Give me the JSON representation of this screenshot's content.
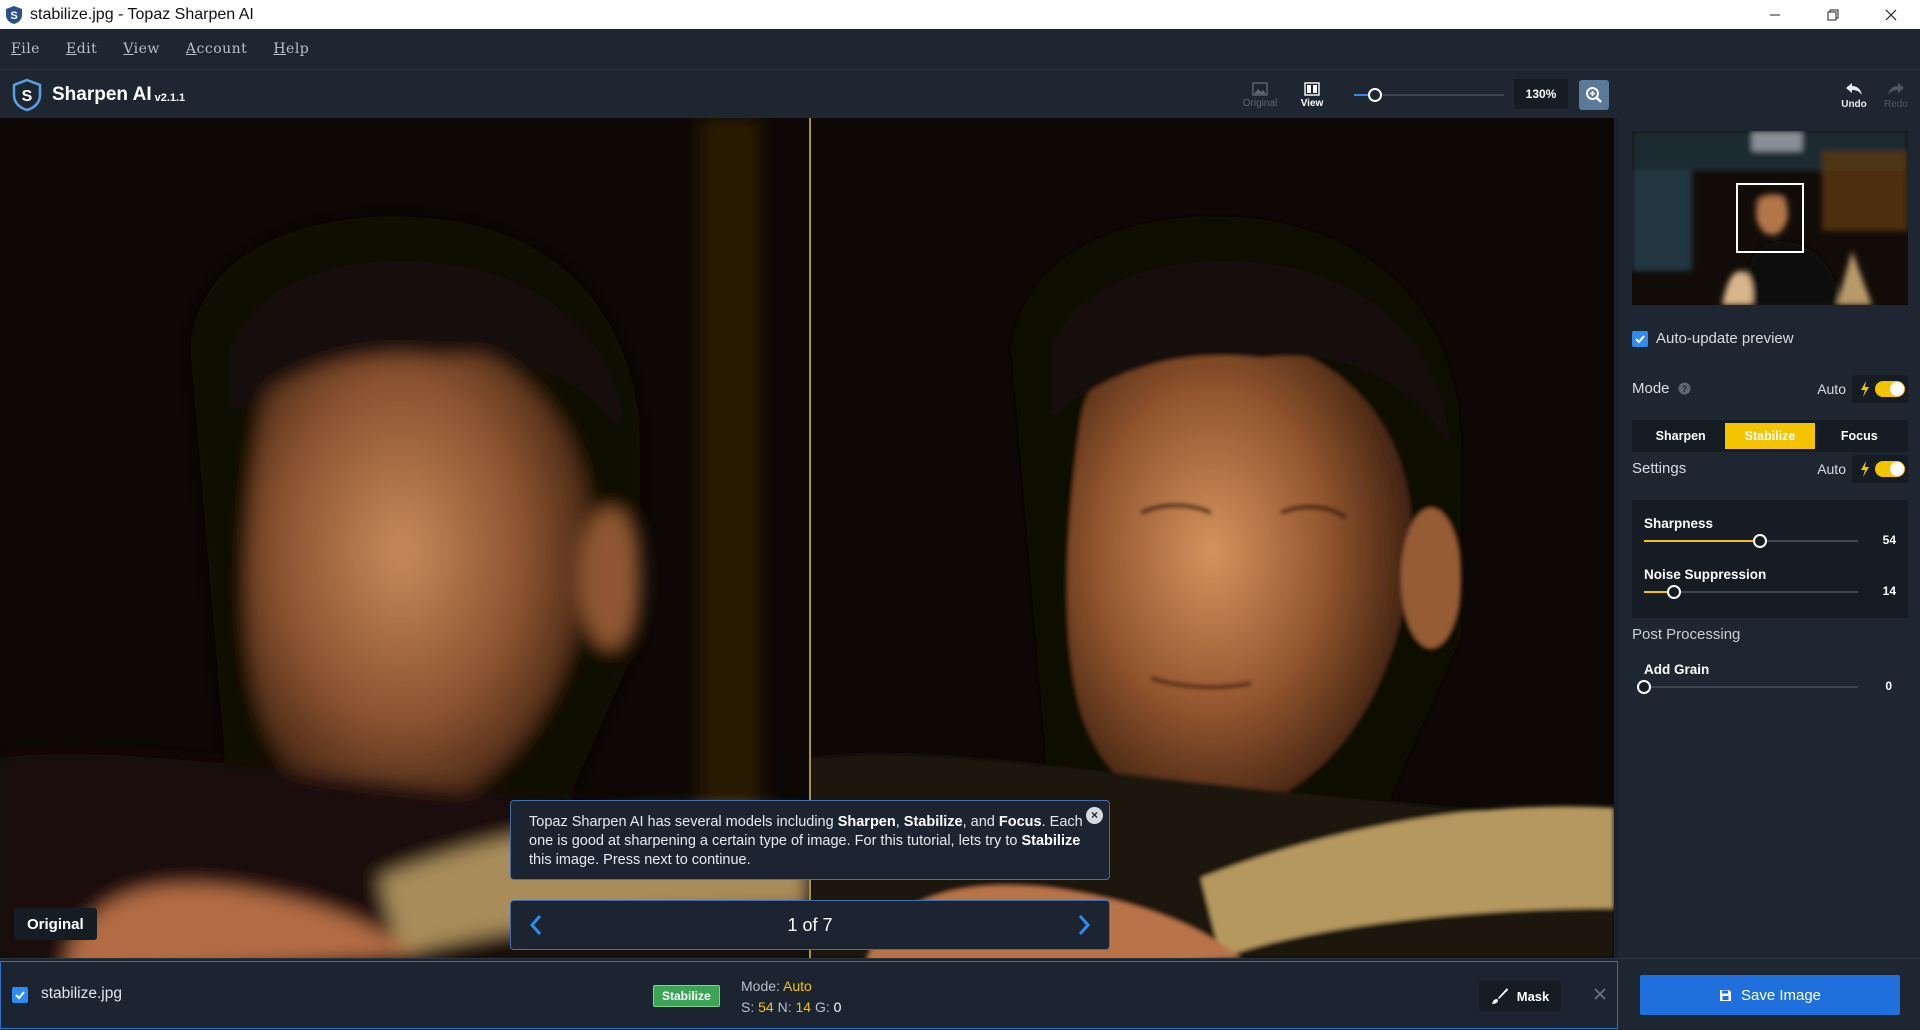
{
  "window": {
    "title": "stabilize.jpg - Topaz Sharpen AI",
    "controls": [
      "minimize",
      "restore",
      "close"
    ]
  },
  "menu": [
    "File",
    "Edit",
    "View",
    "Account",
    "Help"
  ],
  "toolbar": {
    "brand": "Sharpen AI",
    "version": "v2.1.1",
    "original_label": "Original",
    "view_label": "View",
    "zoom_value": "130%",
    "zoom_slider_fraction": 0.14,
    "undo_label": "Undo",
    "redo_label": "Redo"
  },
  "preview": {
    "original_badge": "Original",
    "tutorial": {
      "text_1": "Topaz Sharpen AI has several models including ",
      "b_sharpen": "Sharpen",
      "sep_1": ", ",
      "b_stabilize": "Stabilize",
      "sep_2": ", and ",
      "b_focus": "Focus",
      "text_2": ". Each one is good at sharpening a certain type of image. For this tutorial, lets try to ",
      "b_stabilize_2": "Stabilize",
      "text_3": " this image. Press next to continue.",
      "close_glyph": "×"
    },
    "pager": {
      "text": "1 of 7"
    }
  },
  "panel": {
    "auto_update_label": "Auto-update preview",
    "auto_update_checked": true,
    "mode": {
      "label": "Mode",
      "auto_label": "Auto",
      "auto_on": true,
      "options": [
        "Sharpen",
        "Stabilize",
        "Focus"
      ],
      "selected": "Stabilize"
    },
    "settings": {
      "label": "Settings",
      "auto_label": "Auto",
      "auto_on": true,
      "sliders": [
        {
          "label": "Sharpness",
          "value": "54",
          "fraction": 0.54
        },
        {
          "label": "Noise Suppression",
          "value": "14",
          "fraction": 0.14
        }
      ]
    },
    "post_processing": {
      "label": "Post Processing",
      "sliders": [
        {
          "label": "Add Grain",
          "value": "0",
          "fraction": 0.0
        }
      ]
    }
  },
  "bottom": {
    "file_name": "stabilize.jpg",
    "file_checked": true,
    "model_badge": "Stabilize",
    "mode_prefix": "Mode: ",
    "mode_value": "Auto",
    "s_label": "S: ",
    "s_value": "54",
    "n_label": " N: ",
    "n_value": "14",
    "g_label": " G: ",
    "g_value": "0",
    "mask_label": "Mask",
    "save_label": "Save Image"
  },
  "colors": {
    "accent_yellow": "#f5c400",
    "accent_blue": "#1f6fdc",
    "badge_green": "#3aa655",
    "panel_bg": "#1e2731"
  }
}
